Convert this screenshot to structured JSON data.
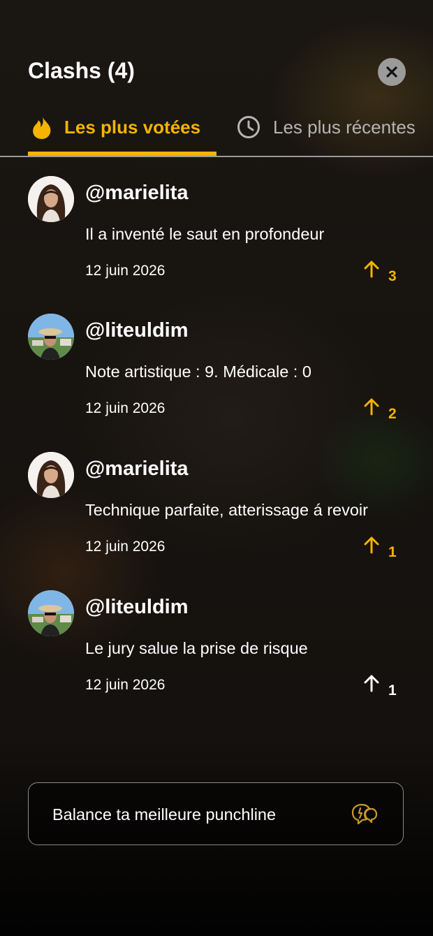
{
  "header": {
    "title": "Clashs (4)",
    "close_icon": "close-icon"
  },
  "tabs": [
    {
      "label": "Les plus votées",
      "icon": "flame-icon",
      "active": true
    },
    {
      "label": "Les plus récentes",
      "icon": "clock-icon",
      "active": false
    }
  ],
  "comments": [
    {
      "username": "@marielita",
      "text": "Il a inventé le saut en profondeur",
      "date": "12 juin 2026",
      "votes": "3",
      "voted": true
    },
    {
      "username": "@liteuldim",
      "text": "Note artistique : 9. Médicale : 0",
      "date": "12 juin 2026",
      "votes": "2",
      "voted": true
    },
    {
      "username": "@marielita",
      "text": "Technique parfaite, atterissage á revoir",
      "date": "12 juin 2026",
      "votes": "1",
      "voted": true
    },
    {
      "username": "@liteuldim",
      "text": "Le jury salue la prise de risque",
      "date": "12 juin 2026",
      "votes": "1",
      "voted": false
    }
  ],
  "composer": {
    "placeholder": "Balance ta meilleure punchline",
    "icon": "punchline-bubbles-icon"
  },
  "colors": {
    "accent": "#f5b400",
    "background": "#14110e",
    "close_button": "#9b9b9b"
  }
}
